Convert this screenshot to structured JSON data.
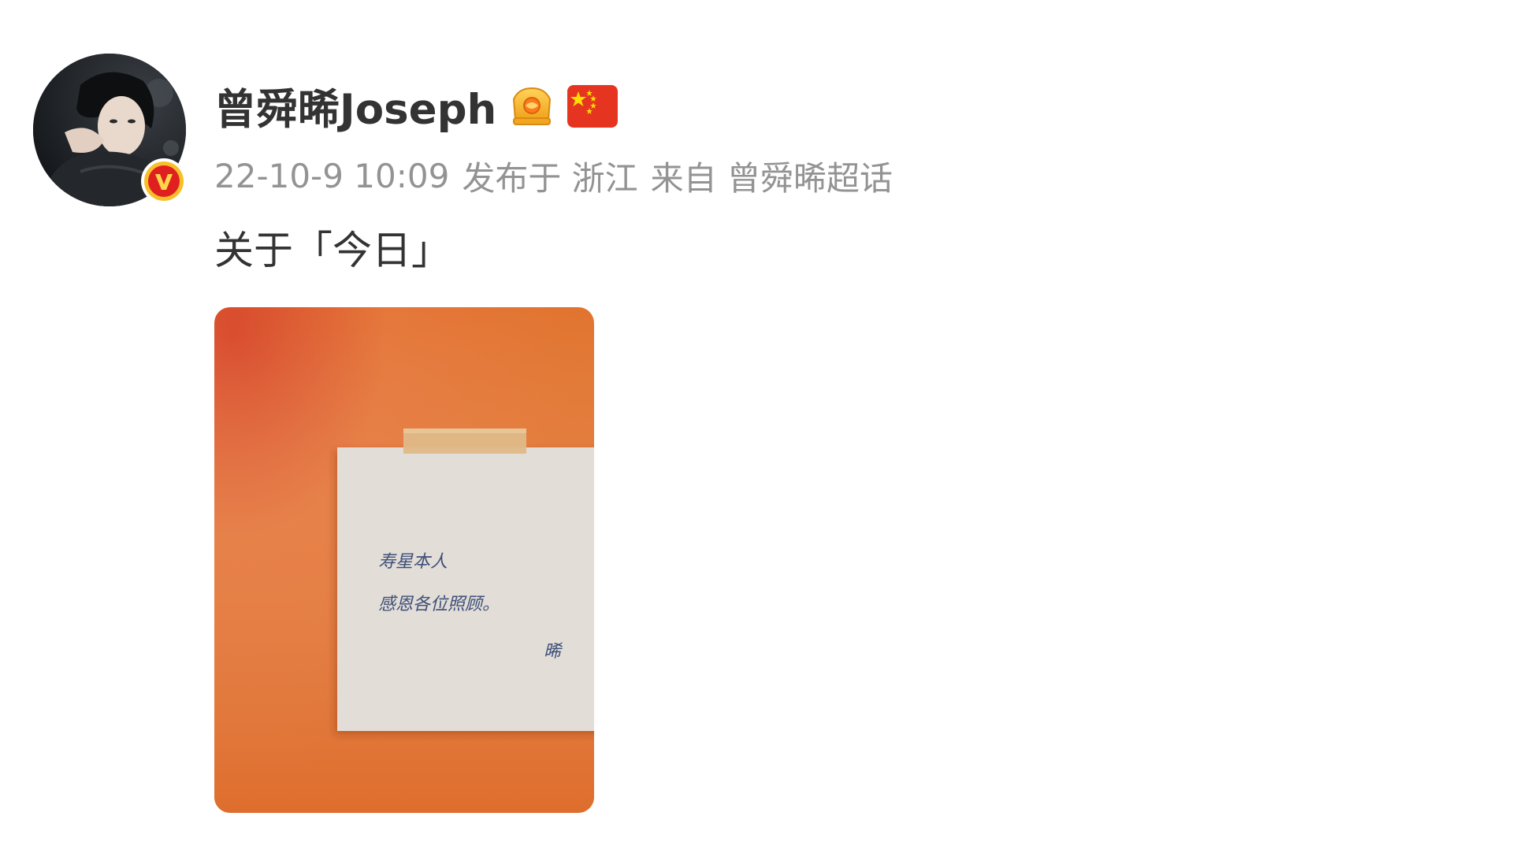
{
  "post": {
    "author": {
      "name": "曾舜晞Joseph",
      "avatar_icon": "avatar-photo",
      "verified_icon": "verified-v-badge",
      "crown_icon": "crown-icon",
      "flag_icon": "china-flag-icon"
    },
    "meta": {
      "time": "22-10-9 10:09",
      "location": "发布于 浙江",
      "source": "来自 曾舜晞超话"
    },
    "text": "关于「今日」",
    "image": {
      "note_lines": [
        "寿星本人",
        "感恩各位照顾。",
        "晞"
      ]
    }
  },
  "colors": {
    "name": "#333333",
    "meta": "#939393",
    "badge_red": "#e02020",
    "badge_yellow": "#f7c02a",
    "image_orange_light": "#e8873a",
    "image_red": "#d64a2c",
    "paper": "#e2ddd6",
    "tape": "#dfb988"
  }
}
